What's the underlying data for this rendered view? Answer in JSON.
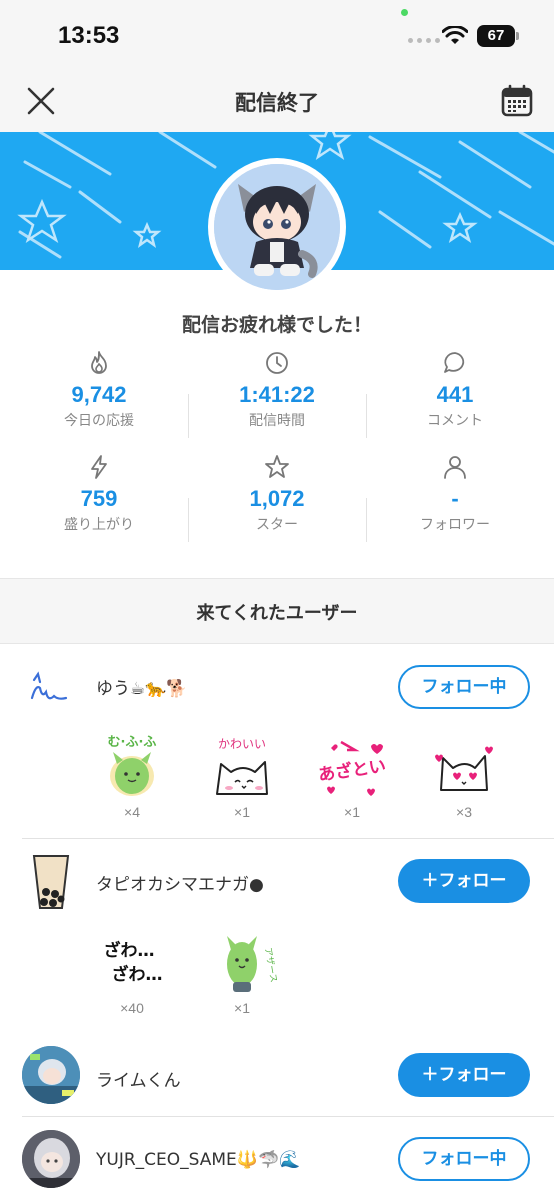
{
  "status_bar": {
    "time": "13:53",
    "battery": "67"
  },
  "header": {
    "title": "配信終了"
  },
  "greeting": "配信お疲れ様でした！",
  "stats": [
    {
      "icon": "fire-icon",
      "value": "9,742",
      "label": "今日の応援"
    },
    {
      "icon": "clock-icon",
      "value": "1:41:22",
      "label": "配信時間"
    },
    {
      "icon": "comment-icon",
      "value": "441",
      "label": "コメント"
    },
    {
      "icon": "lightning-icon",
      "value": "759",
      "label": "盛り上がり"
    },
    {
      "icon": "star-icon",
      "value": "1,072",
      "label": "スター"
    },
    {
      "icon": "person-icon",
      "value": "-",
      "label": "フォロワー"
    }
  ],
  "section": {
    "title": "来てくれたユーザー"
  },
  "users": [
    {
      "name": "ゆう☕🐆🐕",
      "button": "フォロー中",
      "stickers": [
        {
          "name": "mufufu-sticker",
          "text": "む·ふ·ふ",
          "count": "×4"
        },
        {
          "name": "kawaii-cat-sticker",
          "text": "かわいい",
          "count": "×1"
        },
        {
          "name": "atozatoi-sticker",
          "text": "あざとい",
          "count": "×1"
        },
        {
          "name": "heart-eyes-cat-sticker",
          "text": "",
          "count": "×3"
        }
      ]
    },
    {
      "name": "タピオカシマエナガ●",
      "button": "＋フォロー",
      "stickers": [
        {
          "name": "zawa-zawa-sticker",
          "text": "ざわ…",
          "count": "×40"
        },
        {
          "name": "azasu-sticker",
          "text": "アザース",
          "count": "×1"
        }
      ]
    },
    {
      "name": "ライムくん",
      "button": "＋フォロー"
    },
    {
      "name": "YUJR_CEO_SAME🔱🦈🌊",
      "button": "フォロー中"
    }
  ],
  "colors": {
    "accent": "#1a8fe3",
    "banner": "#1fa8f2"
  }
}
